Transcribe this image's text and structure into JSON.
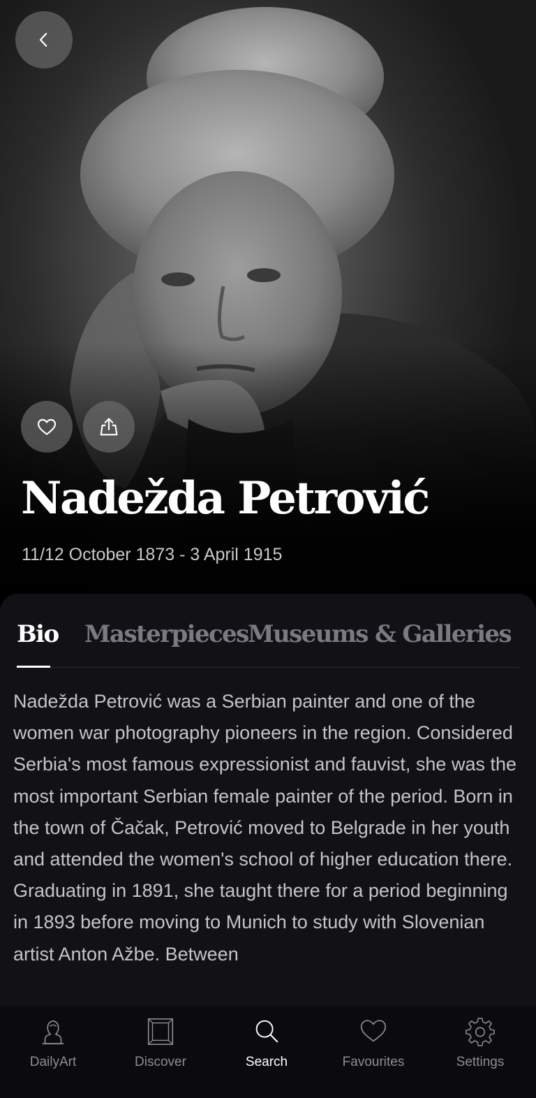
{
  "header": {
    "back_icon": "chevron-left-icon"
  },
  "artist": {
    "name": "Nadežda Petrović",
    "dates": "11/12 October 1873 - 3 April 1915"
  },
  "actions": {
    "favourite_icon": "heart-icon",
    "share_icon": "share-icon"
  },
  "tabs": [
    {
      "label": "Bio",
      "active": true
    },
    {
      "label": "Masterpieces",
      "active": false
    },
    {
      "label": "Museums & Galleries",
      "active": false
    }
  ],
  "bio": {
    "text": "Nadežda Petrović was a Serbian painter and one of the women war photography pioneers in the region. Considered Serbia's most famous expressionist and fauvist, she was the most important Serbian female painter of the period. Born in the town of Čačak, Petrović moved to Belgrade in her youth and attended the women's school of higher education there. Graduating in 1891, she taught there for a period beginning in 1893 before moving to Munich to study with Slovenian artist Anton Ažbe. Between"
  },
  "bottom_nav": {
    "items": [
      {
        "label": "DailyArt",
        "icon": "daily-art-icon",
        "active": false
      },
      {
        "label": "Discover",
        "icon": "frame-icon",
        "active": false
      },
      {
        "label": "Search",
        "icon": "search-icon",
        "active": true
      },
      {
        "label": "Favourites",
        "icon": "heart-icon",
        "active": false
      },
      {
        "label": "Settings",
        "icon": "gear-icon",
        "active": false
      }
    ]
  },
  "colors": {
    "background": "#000000",
    "sheet": "#121216",
    "active_text": "#ffffff",
    "inactive_text": "#7a7a82"
  }
}
